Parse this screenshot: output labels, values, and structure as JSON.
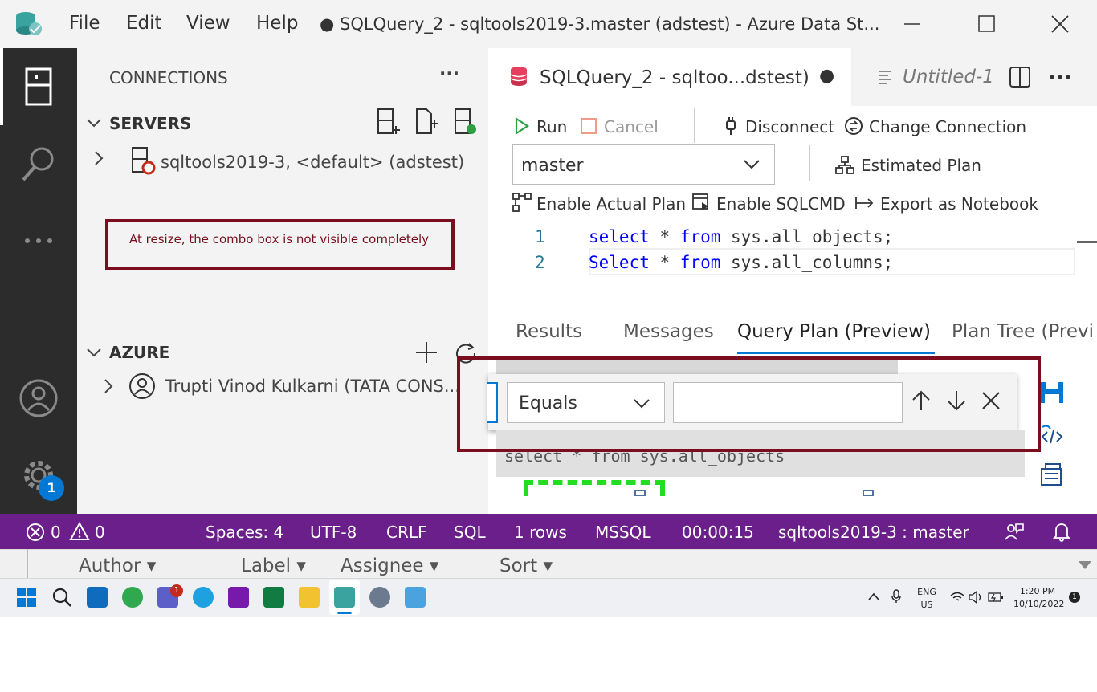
{
  "window": {
    "title": "● SQLQuery_2 - sqltools2019-3.master (adstest) - Azure Data St...",
    "menu": [
      "File",
      "Edit",
      "View",
      "Help"
    ]
  },
  "connections": {
    "title": "CONNECTIONS",
    "more": "···",
    "servers_title": "SERVERS",
    "server_item": "sqltools2019-3, <default> (adstest)",
    "azure_title": "AZURE",
    "azure_item": "Trupti Vinod Kulkarni (TATA CONS..."
  },
  "annotation": {
    "text": "At resize, the combo box is not visible completely"
  },
  "tabs": [
    {
      "label": "SQLQuery_2 - sqltoo...dstest)",
      "dirty": "●"
    },
    {
      "label": "Untitled-1"
    }
  ],
  "toolbar": {
    "run": "Run",
    "cancel": "Cancel",
    "disconnect": "Disconnect",
    "change_connection": "Change Connection",
    "database": "master",
    "estimated_plan": "Estimated Plan",
    "enable_actual_plan": "Enable Actual Plan",
    "enable_sqlcmd": "Enable SQLCMD",
    "export_notebook": "Export as Notebook"
  },
  "code": {
    "lines": [
      {
        "n": "1",
        "kw1": "select",
        "mid": " * ",
        "kw2": "from",
        "rest": " sys.all_objects;"
      },
      {
        "n": "2",
        "kw1": "Select",
        "mid": " * ",
        "kw2": "from",
        "rest": " sys.all_columns;"
      }
    ]
  },
  "results_tabs": [
    "Results",
    "Messages",
    "Query Plan (Preview)",
    "Plan Tree (Previ"
  ],
  "find": {
    "operator": "Equals",
    "value": ""
  },
  "plan": {
    "query": "select * from sys.all_objects"
  },
  "status": {
    "errors": "0",
    "warnings": "0",
    "spaces": "Spaces: 4",
    "encoding": "UTF-8",
    "eol": "CRLF",
    "language": "SQL",
    "rows": "1 rows",
    "provider": "MSSQL",
    "time": "00:00:15",
    "connection": "sqltools2019-3 : master"
  },
  "background_filters": [
    "Author",
    "Label",
    "Assignee",
    "Sort"
  ],
  "taskbar": {
    "lang": "ENG",
    "region": "US",
    "time": "1:20 PM",
    "date": "10/10/2022",
    "notif": "1",
    "teams_badge": "1"
  },
  "gear_badge": "1",
  "colors": {
    "accent": "#6b1f8a",
    "annotation": "#7a0e1e",
    "keyword": "#0000ff"
  }
}
